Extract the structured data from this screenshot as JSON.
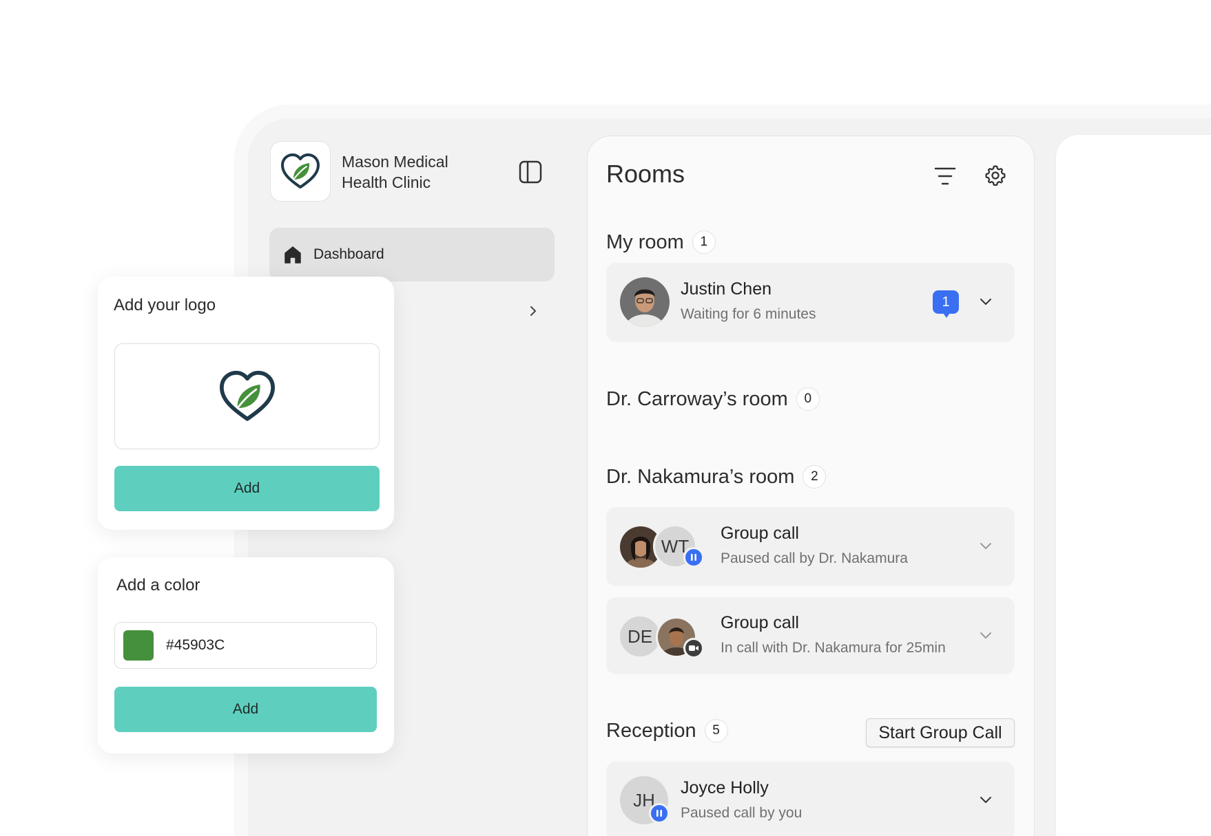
{
  "clinic": {
    "name": "Mason Medical Health Clinic"
  },
  "nav": {
    "dashboard_label": "Dashboard"
  },
  "rooms": {
    "title": "Rooms",
    "sections": [
      {
        "title": "My room",
        "count": "1"
      },
      {
        "title": "Dr. Carroway’s room",
        "count": "0"
      },
      {
        "title": "Dr. Nakamura’s room",
        "count": "2"
      },
      {
        "title": "Reception",
        "count": "5",
        "action_label": "Start Group Call"
      }
    ],
    "cards": [
      {
        "name": "Justin Chen",
        "status": "Waiting for 6 minutes",
        "message_count": "1"
      },
      {
        "name": "Group call",
        "status": "Paused call by Dr. Nakamura",
        "initials": "WT"
      },
      {
        "name": "Group call",
        "status": "In call with Dr. Nakamura for 25min",
        "initials": "DE"
      },
      {
        "name": "Joyce Holly",
        "status": "Paused call by you",
        "initials": "JH"
      }
    ]
  },
  "logo_card": {
    "title": "Add your logo",
    "button_label": "Add"
  },
  "color_card": {
    "title": "Add a color",
    "value": "#45903C",
    "button_label": "Add"
  },
  "colors": {
    "accent": "#5ecfbf",
    "status_blue": "#3a6ff2",
    "brand_green": "#45903C",
    "brand_navy": "#1f3a4a"
  }
}
